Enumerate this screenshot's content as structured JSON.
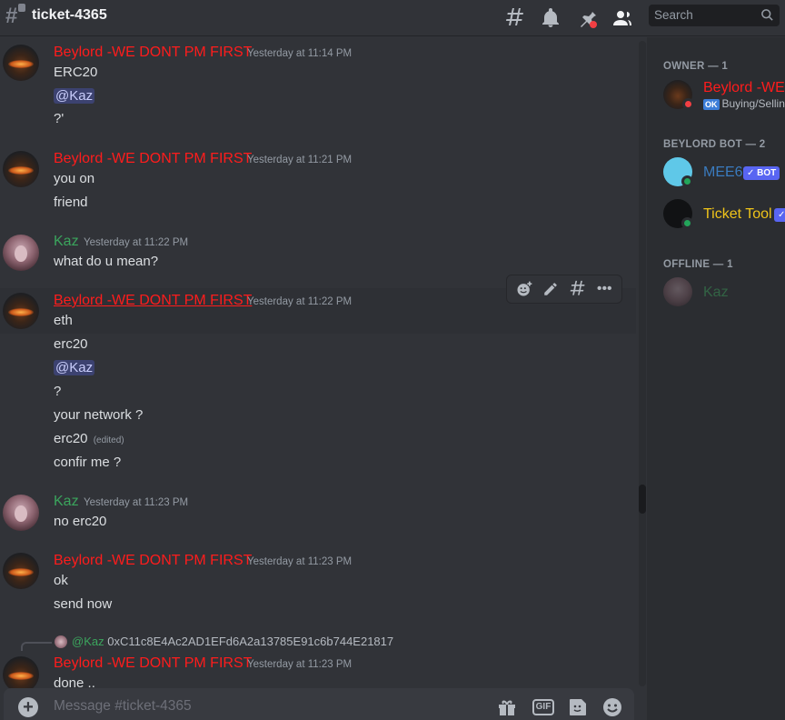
{
  "header": {
    "channel_name": "ticket-4365",
    "search_placeholder": "Search"
  },
  "messages": [
    {
      "author": "Beylord  -WE DONT PM FIRST",
      "timestamp": "Yesterday at 11:14 PM",
      "lines": [
        "ERC20",
        "@Kaz",
        "?'"
      ]
    },
    {
      "author": "Beylord  -WE DONT PM FIRST",
      "timestamp": "Yesterday at 11:21 PM",
      "lines": [
        "you on",
        "friend"
      ]
    },
    {
      "author": "Kaz",
      "timestamp": "Yesterday at 11:22 PM",
      "lines": [
        "what do u mean?"
      ]
    },
    {
      "author": "Beylord  -WE DONT PM FIRST",
      "timestamp": "Yesterday at 11:22 PM",
      "lines": [
        "eth",
        "erc20",
        "@Kaz",
        "?",
        "your network ?",
        "erc20",
        "confir me ?"
      ],
      "edited_label": "(edited)"
    },
    {
      "author": "Kaz",
      "timestamp": "Yesterday at 11:23 PM",
      "lines": [
        "no erc20"
      ]
    },
    {
      "author": "Beylord  -WE DONT PM FIRST",
      "timestamp": "Yesterday at 11:23 PM",
      "lines": [
        "ok",
        "send now"
      ]
    },
    {
      "author": "Beylord  -WE DONT PM FIRST",
      "timestamp": "Yesterday at 11:23 PM",
      "lines": [
        "done .."
      ],
      "reply": {
        "author": "@Kaz",
        "text": "0xC11c8E4Ac2AD1EFd6A2a13785E91c6b744E21817"
      }
    }
  ],
  "composer": {
    "placeholder": "Message #ticket-4365",
    "gif_label": "GIF"
  },
  "members": {
    "sections": [
      {
        "title": "OWNER — 1"
      },
      {
        "title": "BEYLORD BOT — 2"
      },
      {
        "title": "OFFLINE — 1"
      }
    ],
    "owner": {
      "name": "Beylord  -WE DONT PM FIRST",
      "status_badge": "OK",
      "status_text": "Buying/Selling"
    },
    "bots": [
      {
        "name": "MEE6",
        "badge": "✓ BOT"
      },
      {
        "name": "Ticket Tool",
        "badge": "✓"
      }
    ],
    "offline": [
      {
        "name": "Kaz"
      }
    ]
  },
  "colors": {
    "beylord_role": "#ff1c1c",
    "kaz_role": "#3ba55d",
    "mention_bg": "#3c4270",
    "bot_badge": "#5865f2"
  }
}
